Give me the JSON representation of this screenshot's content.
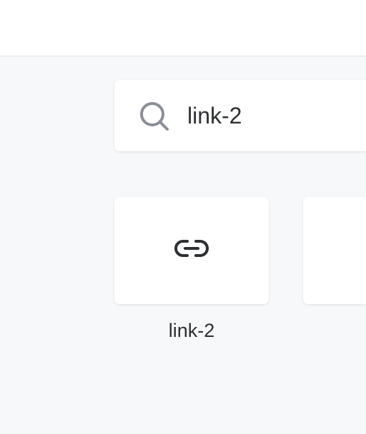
{
  "search": {
    "value": "link-2",
    "icon": "search-icon"
  },
  "results": [
    {
      "label": "link-2",
      "icon": "link-icon"
    },
    {
      "label": "",
      "icon": ""
    }
  ],
  "colors": {
    "background": "#f7f8fa",
    "surface": "#ffffff",
    "text": "#2e3033",
    "icon_muted": "#8a8f96"
  }
}
